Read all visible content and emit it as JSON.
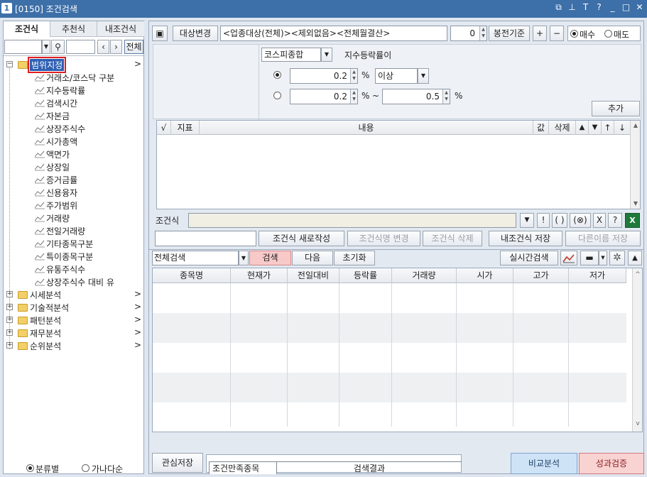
{
  "window": {
    "number": "1",
    "title": "[0150] 조건검색"
  },
  "titlebar_icons": [
    "restore-icon",
    "pin-icon",
    "font-icon",
    "help-icon",
    "minimize-icon",
    "maximize-icon",
    "close-icon"
  ],
  "titlebar_glyphs": [
    "⧉",
    "⊥",
    "T",
    "?",
    "_",
    "□",
    "✕"
  ],
  "left": {
    "tabs": [
      "조건식",
      "추천식",
      "내조건식"
    ],
    "all_button": "전체",
    "tree_root": "범위지정",
    "tree_children": [
      "거래소/코스닥 구분",
      "지수등락률",
      "검색시간",
      "자본금",
      "상장주식수",
      "시가총액",
      "액면가",
      "상장일",
      "증거금률",
      "신용융자",
      "주가범위",
      "거래량",
      "전일거래량",
      "기타종목구분",
      "특이종목구분",
      "유통주식수",
      "상장주식수 대비 유"
    ],
    "tree_groups": [
      "시세분석",
      "기술적분석",
      "패턴분석",
      "재무분석",
      "순위분석"
    ],
    "sort_options": [
      "분류별",
      "가나다순"
    ]
  },
  "top": {
    "target_button": "대상변경",
    "target_value": "<업종대상(전체)><제외없음><전체월결산>",
    "candle_value": "0",
    "candle_label": "봉전기준",
    "plus": "+",
    "minus": "−",
    "buy": "매수",
    "sell": "매도"
  },
  "condition": {
    "index_select": "코스피종합",
    "label": "지수등락률이",
    "row1_value": "0.2",
    "row1_unit": "%",
    "row1_op": "이상",
    "row2_from": "0.2",
    "row2_to": "0.5",
    "unit": "%",
    "tilde": "~",
    "add_button": "추가"
  },
  "indicator_table": {
    "headers": [
      "√",
      "지표",
      "내용",
      "값",
      "삭제",
      "▲",
      "▼",
      "↑",
      "↓"
    ]
  },
  "formula": {
    "label": "조건식",
    "ops": [
      "!",
      "( )",
      "(⊗)",
      "X",
      "?"
    ],
    "buttons": [
      "조건식 새로작성",
      "조건식명 변경",
      "조건식 삭제",
      "내조건식 저장",
      "다른이름 저장"
    ]
  },
  "search": {
    "scope": "전체검색",
    "search_button": "검색",
    "next_button": "다음",
    "reset_button": "초기화",
    "realtime_button": "실시간검색"
  },
  "results_table": {
    "headers": [
      "종목명",
      "현재가",
      "전일대비",
      "등락률",
      "거래량",
      "시가",
      "고가",
      "저가"
    ]
  },
  "bottom": {
    "save_button": "관심저장",
    "tab_match": "조건만족종목",
    "tab_result": "검색결과",
    "compare_button": "비교분석",
    "verify_button": "성과검증"
  },
  "colors": {
    "title_bar": "#3d6fa8",
    "highlight_border": "#e02020",
    "search_button": "#f8c9c9",
    "compare_button": "#cfe3f7",
    "verify_button": "#f9d2d2"
  }
}
